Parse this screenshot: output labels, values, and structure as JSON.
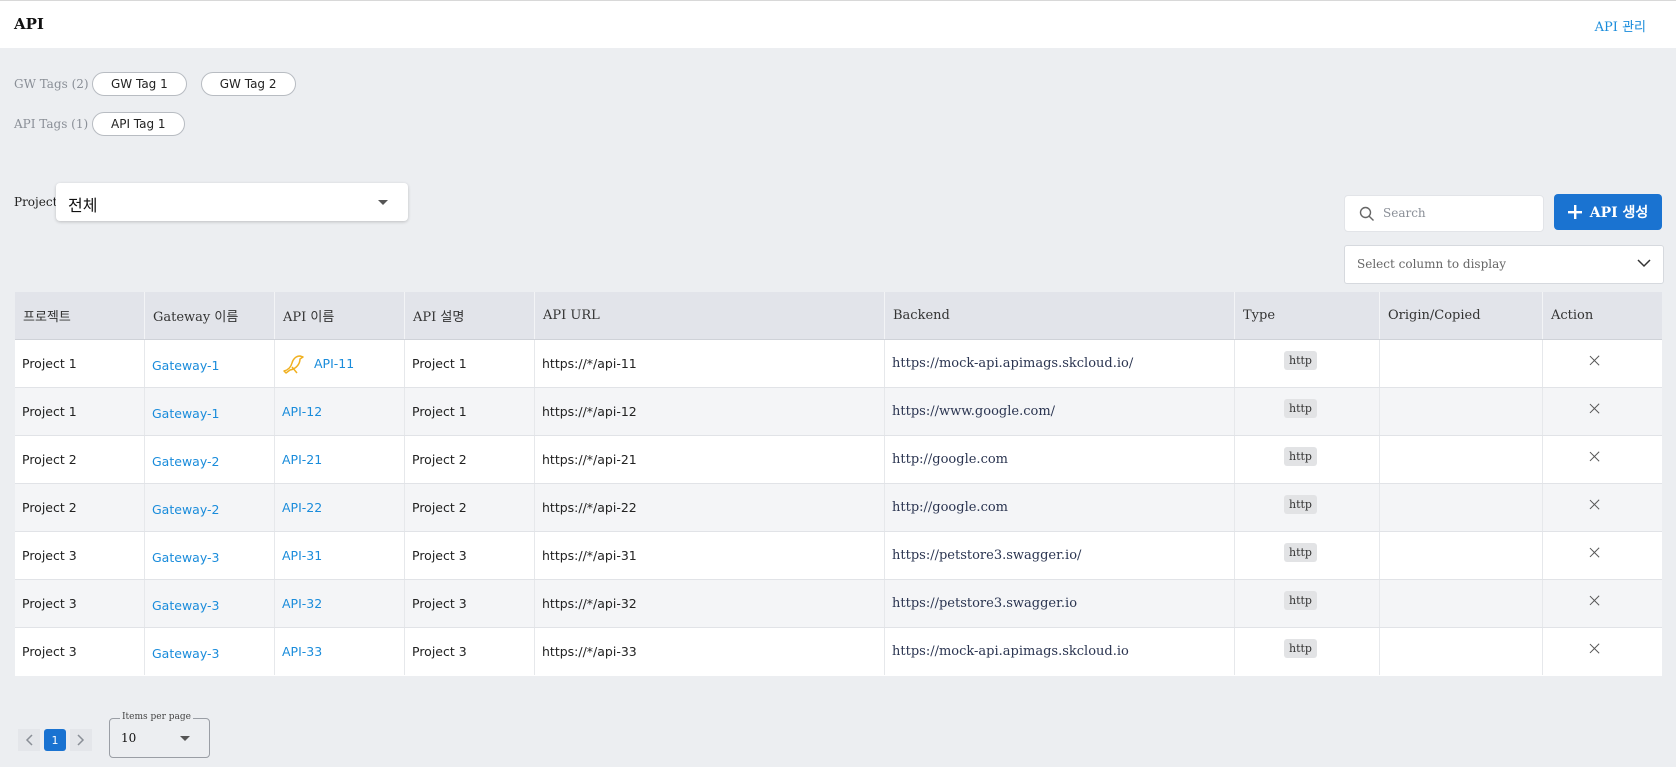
{
  "header": {
    "title": "API",
    "breadcrumb_link": "API 관리"
  },
  "tags": {
    "gw_label": "GW Tags (2)",
    "gw": [
      "GW Tag 1",
      "GW Tag 2"
    ],
    "api_label": "API Tags (1)",
    "api": [
      "API Tag 1"
    ]
  },
  "filters": {
    "project_label": "Project",
    "project_value": "전체",
    "search_placeholder": "Search",
    "create_button": "API 생성",
    "column_select_placeholder": "Select column to display"
  },
  "table": {
    "headers": [
      "프로젝트",
      "Gateway 이름",
      "API 이름",
      "API 설명",
      "API URL",
      "Backend",
      "Type",
      "Origin/Copied",
      "Action"
    ],
    "rows": [
      {
        "project": "Project 1",
        "gateway": "Gateway-1",
        "api": "API-11",
        "desc": "Project 1",
        "url": "https://*/api-11",
        "backend": "https://mock-api.apimags.skcloud.io/",
        "type": "http",
        "origin": "",
        "icon": "bird-icon"
      },
      {
        "project": "Project 1",
        "gateway": "Gateway-1",
        "api": "API-12",
        "desc": "Project 1",
        "url": "https://*/api-12",
        "backend": "https://www.google.com/",
        "type": "http",
        "origin": ""
      },
      {
        "project": "Project 2",
        "gateway": "Gateway-2",
        "api": "API-21",
        "desc": "Project 2",
        "url": "https://*/api-21",
        "backend": "http://google.com",
        "type": "http",
        "origin": ""
      },
      {
        "project": "Project 2",
        "gateway": "Gateway-2",
        "api": "API-22",
        "desc": "Project 2",
        "url": "https://*/api-22",
        "backend": "http://google.com",
        "type": "http",
        "origin": ""
      },
      {
        "project": "Project 3",
        "gateway": "Gateway-3",
        "api": "API-31",
        "desc": "Project 3",
        "url": "https://*/api-31",
        "backend": "https://petstore3.swagger.io/",
        "type": "http",
        "origin": ""
      },
      {
        "project": "Project 3",
        "gateway": "Gateway-3",
        "api": "API-32",
        "desc": "Project 3",
        "url": "https://*/api-32",
        "backend": "https://petstore3.swagger.io",
        "type": "http",
        "origin": ""
      },
      {
        "project": "Project 3",
        "gateway": "Gateway-3",
        "api": "API-33",
        "desc": "Project 3",
        "url": "https://*/api-33",
        "backend": "https://mock-api.apimags.skcloud.io",
        "type": "http",
        "origin": ""
      }
    ]
  },
  "pagination": {
    "current_page": "1",
    "items_per_page_label": "Items per page",
    "items_per_page": "10"
  },
  "colors": {
    "accent": "#1a73d1",
    "link": "#1a8cdb",
    "bird_icon": "#f0b020"
  }
}
